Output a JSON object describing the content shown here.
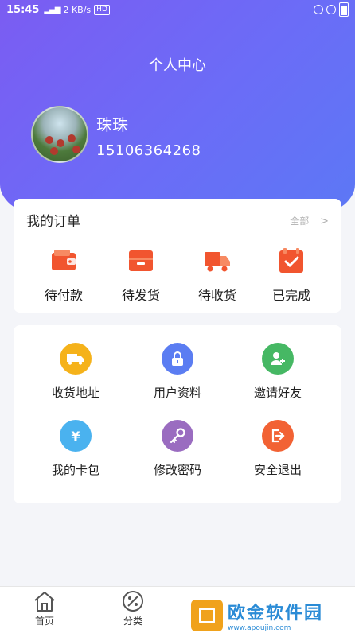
{
  "status_bar": {
    "time": "15:45",
    "signal": "4G",
    "net_speed": "2 KB/s",
    "hd": "HD"
  },
  "header": {
    "title": "个人中心"
  },
  "user": {
    "name": "珠珠",
    "phone": "15106364268"
  },
  "orders": {
    "title": "我的订单",
    "all_label": "全部",
    "chevron": ">",
    "items": [
      {
        "label": "待付款",
        "icon": "wallet-icon",
        "color": "#f1552f"
      },
      {
        "label": "待发货",
        "icon": "box-icon",
        "color": "#f1552f"
      },
      {
        "label": "待收货",
        "icon": "truck-icon",
        "color": "#f1552f"
      },
      {
        "label": "已完成",
        "icon": "check-box-icon",
        "color": "#f1552f"
      }
    ]
  },
  "tools": {
    "items": [
      {
        "label": "收货地址",
        "icon": "truck-icon",
        "color": "#f5b21a"
      },
      {
        "label": "用户资料",
        "icon": "lock-icon",
        "color": "#5b7df2"
      },
      {
        "label": "邀请好友",
        "icon": "add-user-icon",
        "color": "#46b864"
      },
      {
        "label": "我的卡包",
        "icon": "yen-icon",
        "color": "#4ab2ef",
        "glyph": "¥"
      },
      {
        "label": "修改密码",
        "icon": "key-icon",
        "color": "#9a6cc0"
      },
      {
        "label": "安全退出",
        "icon": "logout-icon",
        "color": "#f26234"
      }
    ]
  },
  "tabbar": {
    "items": [
      {
        "label": "首页",
        "icon": "home-icon"
      },
      {
        "label": "分类",
        "icon": "category-icon"
      }
    ]
  },
  "watermark": {
    "text": "欧金软件园",
    "url": "www.apoujin.com"
  }
}
